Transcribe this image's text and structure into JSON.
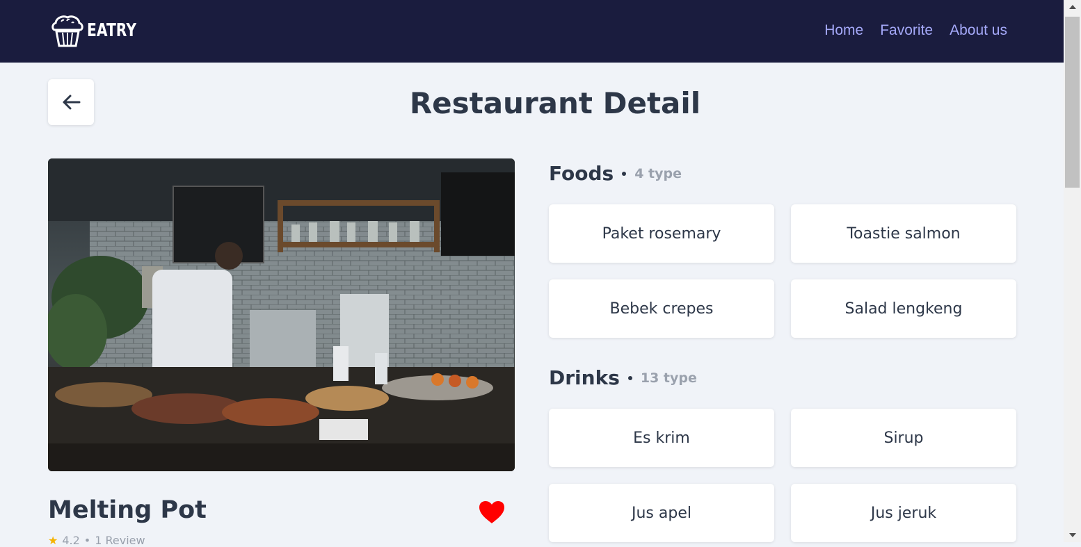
{
  "brand": {
    "name": "EATRY",
    "logo_icon": "muffin-icon"
  },
  "nav": {
    "links": [
      "Home",
      "Favorite",
      "About us"
    ]
  },
  "header": {
    "back_icon": "arrow-left-icon",
    "title": "Restaurant Detail"
  },
  "restaurant": {
    "name": "Melting Pot",
    "rating": "4.2",
    "reviews": "1 Review",
    "favorite_icon": "heart-icon"
  },
  "menus": {
    "foods": {
      "title": "Foods",
      "count": "4 type",
      "items": [
        "Paket rosemary",
        "Toastie salmon",
        "Bebek crepes",
        "Salad lengkeng"
      ]
    },
    "drinks": {
      "title": "Drinks",
      "count": "13 type",
      "items": [
        "Es krim",
        "Sirup",
        "Jus apel",
        "Jus jeruk"
      ]
    }
  },
  "colors": {
    "navbar": "#1a1c3e",
    "nav_link": "#a5a9f9",
    "heart": "#ff0000",
    "background": "#f0f3f8"
  }
}
